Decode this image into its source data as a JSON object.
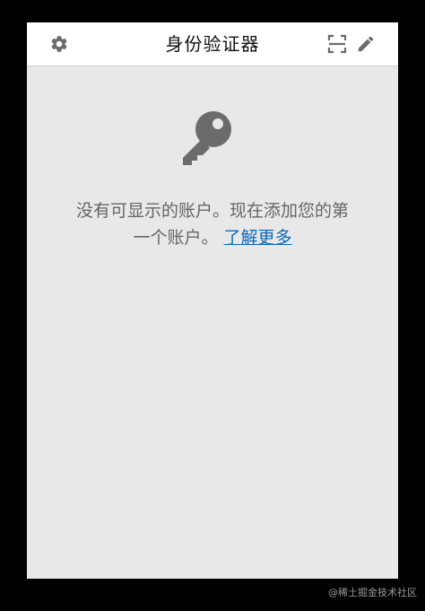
{
  "header": {
    "title": "身份验证器",
    "icons": {
      "settings": "gear-icon",
      "scan": "qr-scan-icon",
      "edit": "pencil-icon"
    }
  },
  "empty_state": {
    "icon": "key-icon",
    "message_line1": "没有可显示的账户。现在添加您的第",
    "message_line2": "一个账户。",
    "learn_more": "了解更多"
  },
  "watermark": "@稀土掘金技术社区",
  "colors": {
    "background": "#e8e8e8",
    "header_bg": "#ffffff",
    "icon_gray": "#6b6b6b",
    "text_gray": "#666666",
    "link_blue": "#0b69b8"
  }
}
